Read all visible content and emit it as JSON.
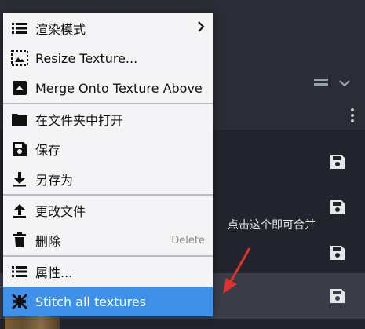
{
  "menu": {
    "items": [
      {
        "label": "渲染模式",
        "icon": "list-icon"
      },
      {
        "label": "Resize Texture...",
        "icon": "resize-icon"
      },
      {
        "label": "Merge Onto Texture Above",
        "icon": "merge-up-icon"
      },
      {
        "label": "在文件夹中打开",
        "icon": "folder-icon"
      },
      {
        "label": "保存",
        "icon": "save-icon"
      },
      {
        "label": "另存为",
        "icon": "download-icon"
      },
      {
        "label": "更改文件",
        "icon": "upload-icon"
      },
      {
        "label": "删除",
        "icon": "trash-icon",
        "shortcut": "Delete"
      },
      {
        "label": "属性...",
        "icon": "list-icon"
      },
      {
        "label": "Stitch all textures",
        "icon": "stitch-icon"
      }
    ]
  },
  "annotation": {
    "text": "点击这个即可合并"
  },
  "colors": {
    "menu_bg": "#f4f4f6",
    "active_bg": "#3e90e8",
    "app_bg": "#21242c",
    "annotation_arrow": "#e0322c"
  }
}
